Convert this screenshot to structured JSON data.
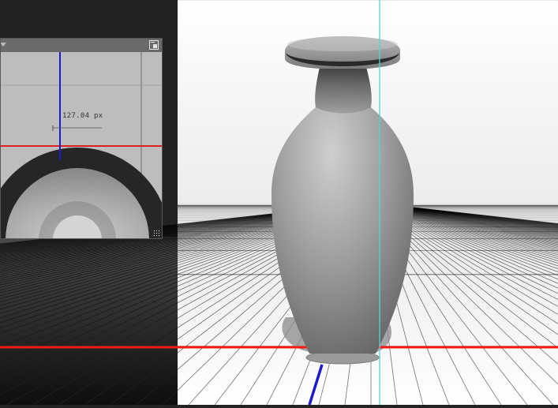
{
  "view_panel": {
    "measurement_label": "127.04 px",
    "menu_icon": "dropdown-arrow-icon",
    "dock_icon": "undock-icon",
    "resize_icon": "resize-grip-icon"
  },
  "scene": {
    "object": "vase",
    "x_axis_color": "#ff1a1a",
    "z_axis_color": "#1a1ad0",
    "guide_color": "#5ad0d8",
    "grid_line_light": "#000000",
    "grid_line_dark": "#3a3a3a"
  }
}
